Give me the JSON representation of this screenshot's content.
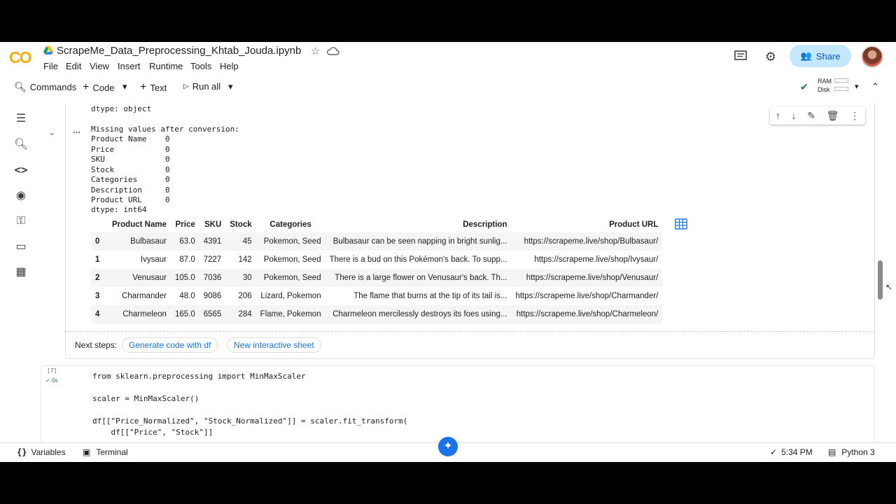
{
  "header": {
    "logo": "CO",
    "notebook_title": "ScrapeMe_Data_Preprocessing_Khtab_Jouda.ipynb",
    "share_label": "Share"
  },
  "menu": [
    "File",
    "Edit",
    "View",
    "Insert",
    "Runtime",
    "Tools",
    "Help"
  ],
  "toolbar": {
    "commands": "Commands",
    "code": "Code",
    "text": "Text",
    "run_all": "Run all",
    "ram": "RAM",
    "disk": "Disk"
  },
  "output": {
    "dtype_object": "dtype: object",
    "missing_header": "Missing values after conversion:",
    "missing": [
      "Product Name    0",
      "Price           0",
      "SKU             0",
      "Stock           0",
      "Categories      0",
      "Description     0",
      "Product URL     0"
    ],
    "dtype_int": "dtype: int64",
    "ellipsis": "..."
  },
  "dataframe": {
    "columns": [
      "",
      "Product Name",
      "Price",
      "SKU",
      "Stock",
      "Categories",
      "Description",
      "Product URL"
    ],
    "rows": [
      [
        "0",
        "Bulbasaur",
        "63.0",
        "4391",
        "45",
        "Pokemon, Seed",
        "Bulbasaur can be seen napping in bright sunlig...",
        "https://scrapeme.live/shop/Bulbasaur/"
      ],
      [
        "1",
        "Ivysaur",
        "87.0",
        "7227",
        "142",
        "Pokemon, Seed",
        "There is a bud on this Pokémon's back. To supp...",
        "https://scrapeme.live/shop/Ivysaur/"
      ],
      [
        "2",
        "Venusaur",
        "105.0",
        "7036",
        "30",
        "Pokemon, Seed",
        "There is a large flower on Venusaur's back. Th...",
        "https://scrapeme.live/shop/Venusaur/"
      ],
      [
        "3",
        "Charmander",
        "48.0",
        "9086",
        "206",
        "Lizard, Pokemon",
        "The flame that burns at the tip of its tail is...",
        "https://scrapeme.live/shop/Charmander/"
      ],
      [
        "4",
        "Charmeleon",
        "165.0",
        "6565",
        "284",
        "Flame, Pokemon",
        "Charmeleon mercilessly destroys its foes using...",
        "https://scrapeme.live/shop/Charmeleon/"
      ]
    ]
  },
  "next_steps": {
    "label": "Next steps:",
    "chip1": "Generate code with df",
    "chip2": "New interactive sheet"
  },
  "code_cell": {
    "exec_count": "[7]",
    "duration": "0s",
    "lines": [
      "from sklearn.preprocessing import MinMaxScaler",
      "scaler = MinMaxScaler()",
      "df[[\"Price_Normalized\", \"Stock_Normalized\"]] = scaler.fit_transform(",
      "    df[[\"Price\", \"Stock\"]]"
    ]
  },
  "statusbar": {
    "variables": "Variables",
    "terminal": "Terminal",
    "time": "5:34 PM",
    "runtime": "Python 3"
  }
}
